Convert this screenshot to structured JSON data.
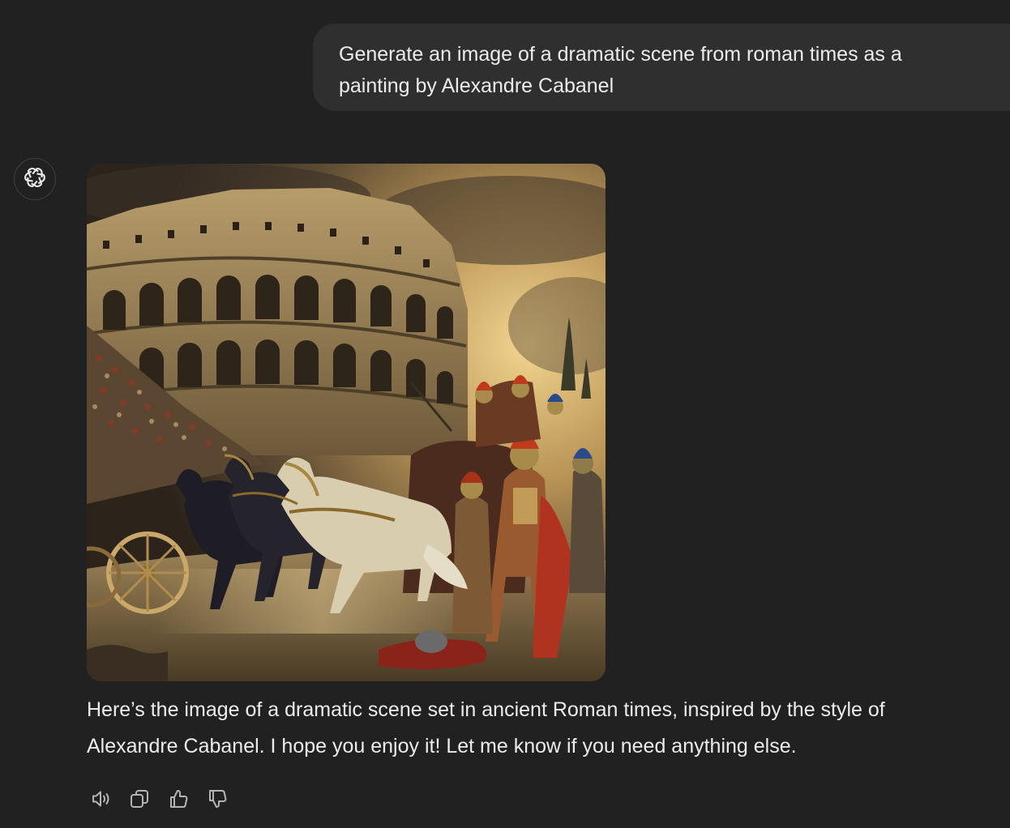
{
  "conversation": {
    "user_message": "Generate an image of a dramatic scene from roman times as a painting by Alexandre Cabanel",
    "assistant": {
      "avatar_icon": "openai-logo-icon",
      "image": {
        "subject": "colosseum-chariot-scene"
      },
      "response_text": "Here’s the image of a dramatic scene set in ancient Roman times, inspired by the style of Alexandre Cabanel. I hope you enjoy it! Let me know if you need anything else.",
      "actions": [
        {
          "icon": "speaker-icon",
          "name": "read-aloud-button"
        },
        {
          "icon": "copy-icon",
          "name": "copy-button"
        },
        {
          "icon": "thumbs-up-icon",
          "name": "good-response-button"
        },
        {
          "icon": "thumbs-down-icon",
          "name": "bad-response-button"
        }
      ]
    }
  },
  "colors": {
    "background": "#212121",
    "user_bubble": "#2f2f2f",
    "text": "#ececec",
    "icon": "#b4b4b4"
  }
}
